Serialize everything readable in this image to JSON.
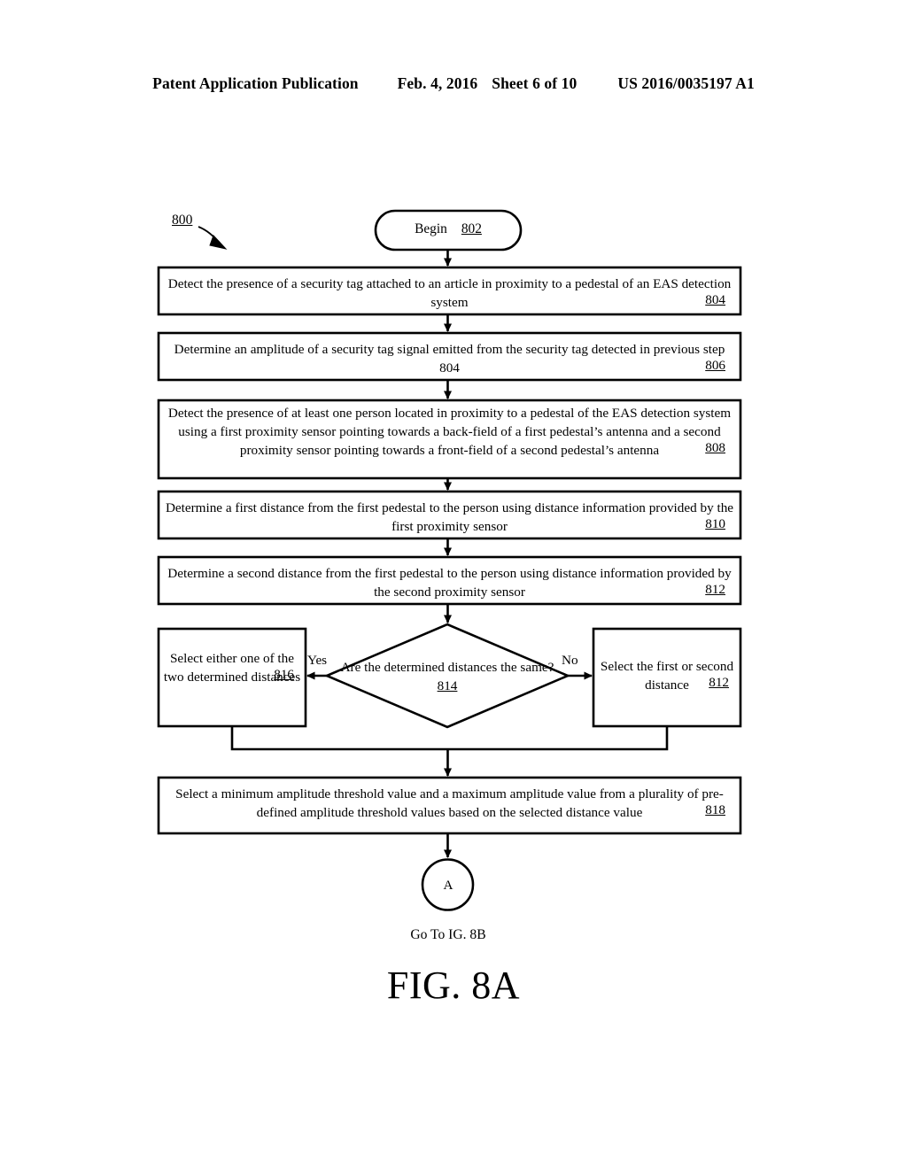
{
  "header": {
    "publication": "Patent Application Publication",
    "date": "Feb. 4, 2016",
    "sheet": "Sheet 6 of 10",
    "patent_number": "US 2016/0035197 A1"
  },
  "figure": {
    "caption": "FIG. 8A",
    "diagram_ref": "800",
    "goto_label": "Go To  IG. 8B",
    "connector_label": "A",
    "branch_yes": "Yes",
    "branch_no": "No",
    "nodes": {
      "begin": {
        "label": "Begin",
        "ref": "802"
      },
      "step_804": {
        "text": "Detect the presence of a security tag attached to an article in proximity to a pedestal of an EAS detection system",
        "ref": "804"
      },
      "step_806": {
        "text": "Determine an amplitude of a security tag signal emitted from the security tag detected in previous step 804",
        "ref": "806"
      },
      "step_808": {
        "text": "Detect the presence of at least one person located in proximity to a pedestal of the EAS detection system using a first proximity sensor pointing towards a back-field of a first pedestal’s antenna and a second proximity sensor pointing towards a front-field of a second pedestal’s antenna",
        "ref": "808"
      },
      "step_810": {
        "text": "Determine a first distance from the first pedestal to the person using distance information provided by the first proximity sensor",
        "ref": "810"
      },
      "step_812": {
        "text": "Determine a second distance from the first pedestal to the person using distance information provided by the second proximity sensor",
        "ref": "812"
      },
      "decision_814": {
        "text": "Are the determined distances the same?",
        "ref": "814"
      },
      "step_816": {
        "text": "Select either one of the two determined distances",
        "ref": "816"
      },
      "step_812b": {
        "text": "Select the first or second distance",
        "ref": "812"
      },
      "step_818": {
        "text": "Select a minimum amplitude threshold value and a maximum amplitude value from a plurality of pre-defined amplitude threshold values based on the selected distance value",
        "ref": "818"
      }
    }
  },
  "colors": {
    "ink": "#000000",
    "paper": "#ffffff"
  }
}
